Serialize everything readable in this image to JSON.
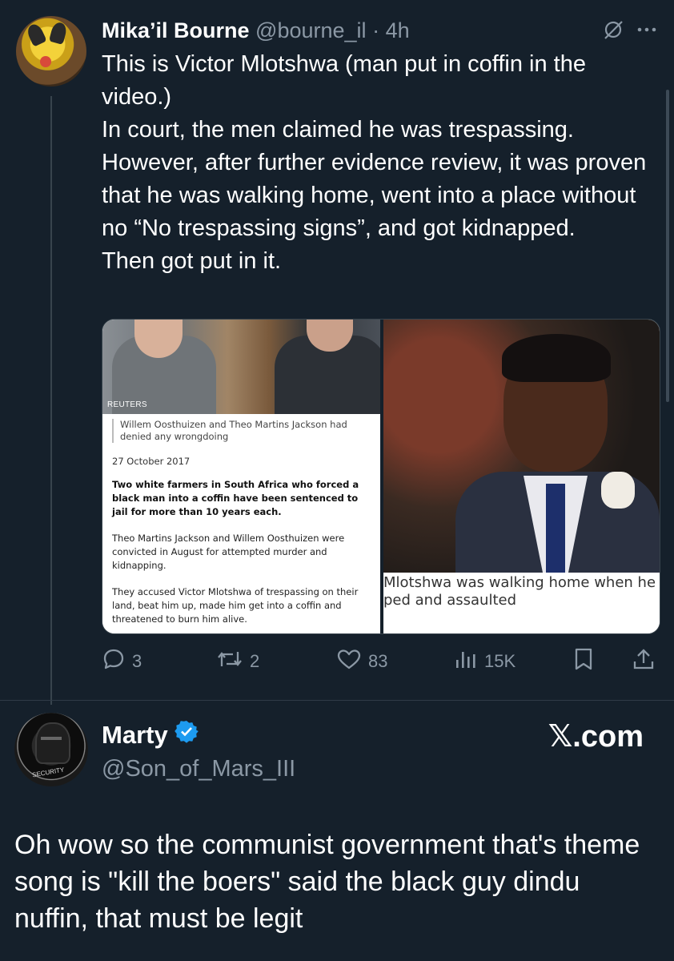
{
  "tweet": {
    "author_name": "Mika’il Bourne",
    "handle": "@bourne_il",
    "separator": "·",
    "time": "4h",
    "lines": [
      "This is Victor Mlotshwa (man put in coffin in the video.)",
      "In court, the men claimed he was trespassing. However, after further evidence review, it was proven that he was walking home, went into a place without no “No trespassing signs”, and got kidnapped.",
      "Then got put in it."
    ],
    "media": {
      "left": {
        "agency": "REUTERS",
        "caption": "Willem Oosthuizen and Theo Martins Jackson had denied any wrongdoing",
        "date": "27 October 2017",
        "headline": "Two white farmers in South Africa who forced a black man into a coffin have been sentenced to jail for more than 10 years each.",
        "para1": "Theo Martins Jackson and Willem Oosthuizen were convicted in August for attempted murder and kidnapping.",
        "para2": "They accused Victor Mlotshwa of trespassing on their land, beat him up, made him get into a coffin and threatened to burn him alive."
      },
      "right": {
        "caption_line1": "Mlotshwa was walking home when he wa",
        "caption_line2": "ped and assaulted"
      }
    },
    "actions": {
      "replies": "3",
      "reposts": "2",
      "likes": "83",
      "views": "15K"
    }
  },
  "post": {
    "author_name": "Marty",
    "handle": "@Son_of_Mars_III",
    "brand": "𝕏.com",
    "avatar_text": "SECURITY",
    "text": "Oh wow so the communist government that's theme song is \"kill the boers\" said the black guy dindu nuffin, that must be legit"
  },
  "colors": {
    "background": "#15202b",
    "text": "#ffffff",
    "muted": "#8b98a5",
    "verified": "#1d9bf0"
  },
  "icons": [
    "grok-icon",
    "more-icon",
    "reply-icon",
    "repost-icon",
    "like-icon",
    "views-icon",
    "bookmark-icon",
    "share-icon",
    "verified-badge-icon"
  ]
}
